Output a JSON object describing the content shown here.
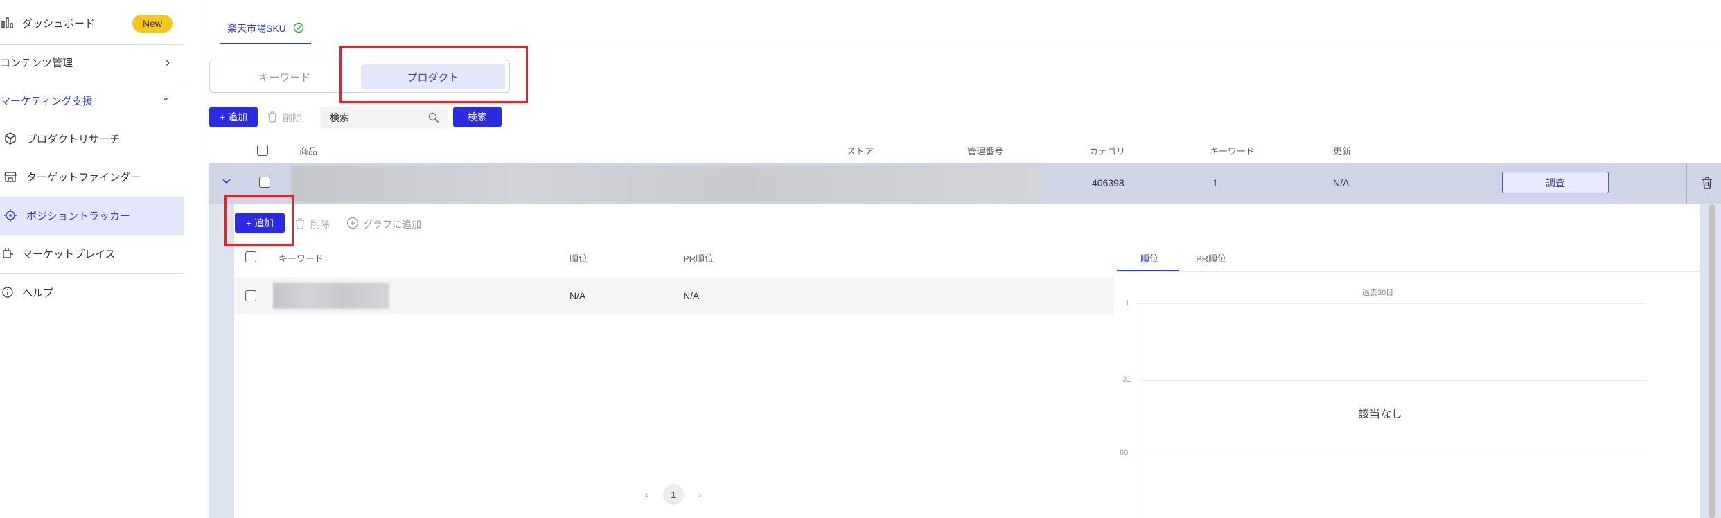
{
  "sidebar": {
    "items": [
      {
        "label": "ダッシュボード",
        "icon": "bar-chart-icon",
        "badge": "New"
      },
      {
        "label": "コンテンツ管理",
        "icon": "",
        "chevron": "›"
      },
      {
        "label": "マーケティング支援",
        "icon": "",
        "chevron": "⌄"
      },
      {
        "label": "プロダクトリサーチ",
        "icon": "cube-icon"
      },
      {
        "label": "ターゲットファインダー",
        "icon": "store-icon"
      },
      {
        "label": "ポジショントラッカー",
        "icon": "crosshair-icon"
      },
      {
        "label": "マーケットプレイス",
        "icon": "plug-icon"
      },
      {
        "label": "ヘルプ",
        "icon": "info-icon"
      }
    ]
  },
  "top_tabs": [
    {
      "label": "楽天市場SKU",
      "status_icon": "check-circle-icon"
    }
  ],
  "mode_switch": {
    "options": [
      "キーワード",
      "プロダクト"
    ],
    "selected": "プロダクト"
  },
  "toolbar": {
    "add_label": "+ 追加",
    "delete_label": "削除",
    "search_placeholder": "検索",
    "search_button": "検索"
  },
  "table": {
    "headers": [
      "商品",
      "ストア",
      "管理番号",
      "カテゴリ",
      "キーワード",
      "更新"
    ],
    "rows": [
      {
        "category": "406398",
        "keywords": "1",
        "updated": "N/A",
        "action": "調査"
      }
    ]
  },
  "keyword_panel": {
    "add_label": "+ 追加",
    "delete_label": "削除",
    "add_to_graph_label": "グラフに追加",
    "headers": [
      "キーワード",
      "順位",
      "PR順位"
    ],
    "rows": [
      {
        "rank": "N/A",
        "pr_rank": "N/A"
      }
    ],
    "pagination": {
      "current": "1"
    }
  },
  "chart_panel": {
    "tabs": [
      "順位",
      "PR順位"
    ],
    "selected_tab": "順位",
    "period": "過去30日",
    "empty_text": "該当なし"
  },
  "chart_data": {
    "type": "line",
    "title": "過去30日",
    "y_ticks": [
      "1",
      "31",
      "60"
    ],
    "ylim": [
      1,
      60
    ],
    "y_inverted": true,
    "series": [],
    "empty_message": "該当なし"
  },
  "colors": {
    "accent": "#2b2be3",
    "highlight_box": "#e1262b",
    "badge": "#f7c81b"
  }
}
